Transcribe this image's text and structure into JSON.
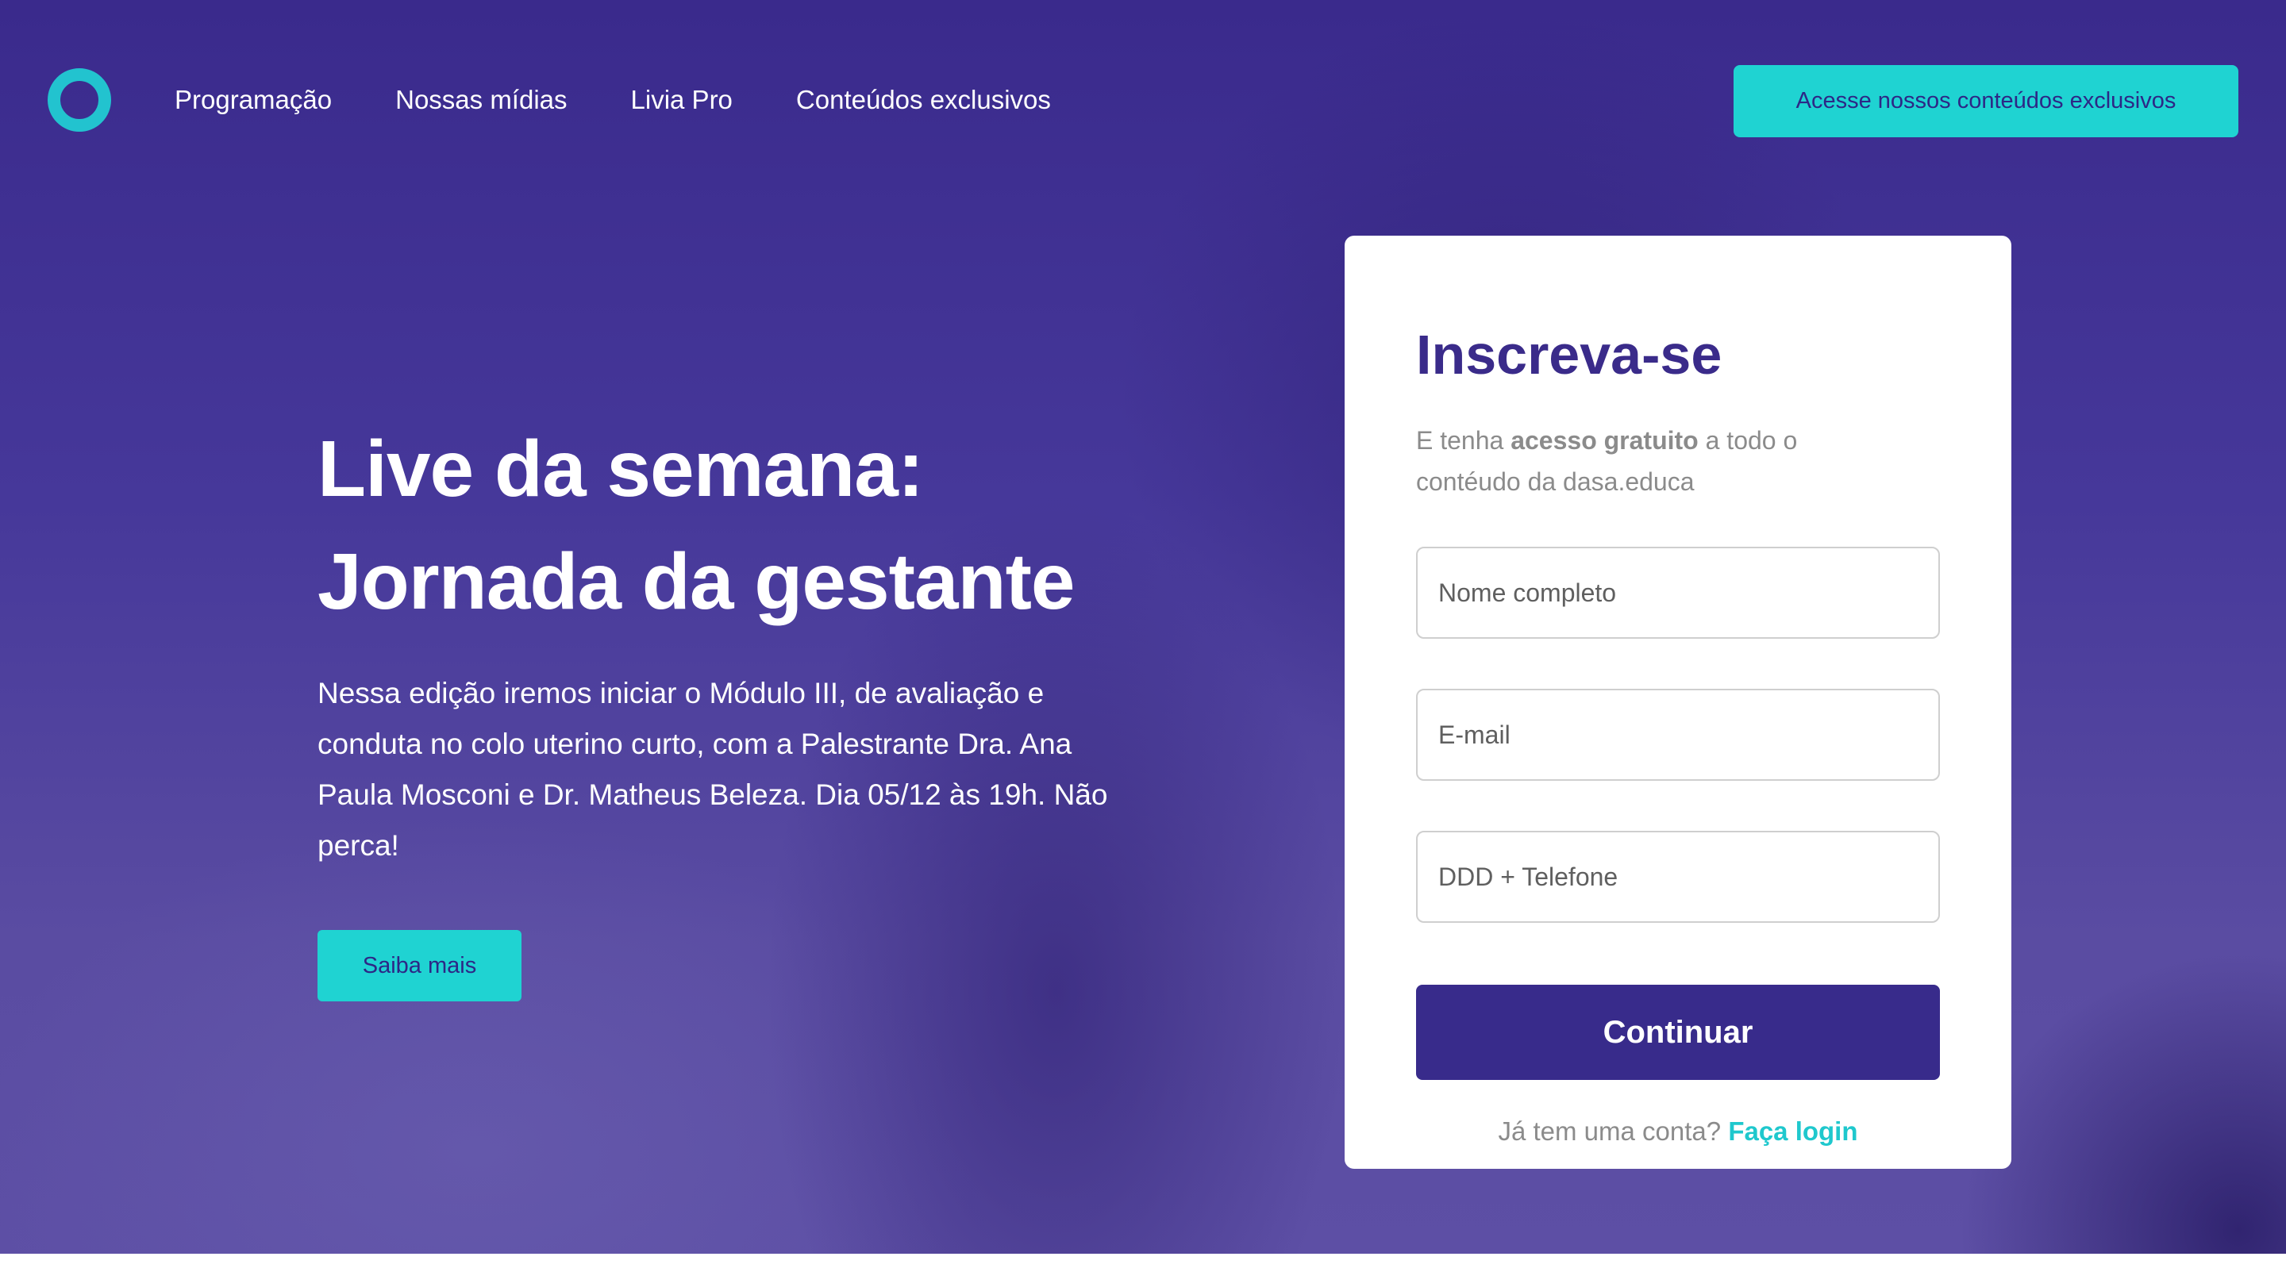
{
  "header": {
    "nav": [
      "Programação",
      "Nossas mídias",
      "Livia Pro",
      "Conteúdos exclusivos"
    ],
    "cta_label": "Acesse nossos conteúdos exclusivos"
  },
  "hero": {
    "headline_line1": "Live da semana:",
    "headline_line2": "Jornada da gestante",
    "description": "Nessa edição iremos iniciar o Módulo III, de avaliação e conduta no colo uterino curto, com a Palestrante Dra. Ana Paula Mosconi e Dr. Matheus Beleza. Dia 05/12 às 19h. Não perca!",
    "button_label": "Saiba mais"
  },
  "form": {
    "title": "Inscreva-se",
    "subtitle_prefix": "E tenha ",
    "subtitle_bold": "acesso gratuito",
    "subtitle_suffix": " a todo o contéudo da dasa.educa",
    "name_placeholder": "Nome completo",
    "email_placeholder": "E-mail",
    "phone_placeholder": "DDD + Telefone",
    "submit_label": "Continuar",
    "login_prompt": "Já tem uma conta?",
    "login_link": "Faça login"
  },
  "colors": {
    "brand_purple": "#382b8b",
    "accent_cyan": "#1fd3d2",
    "title_purple": "#3a2b8a"
  },
  "icons": {
    "logo": "ring-logo-icon"
  }
}
